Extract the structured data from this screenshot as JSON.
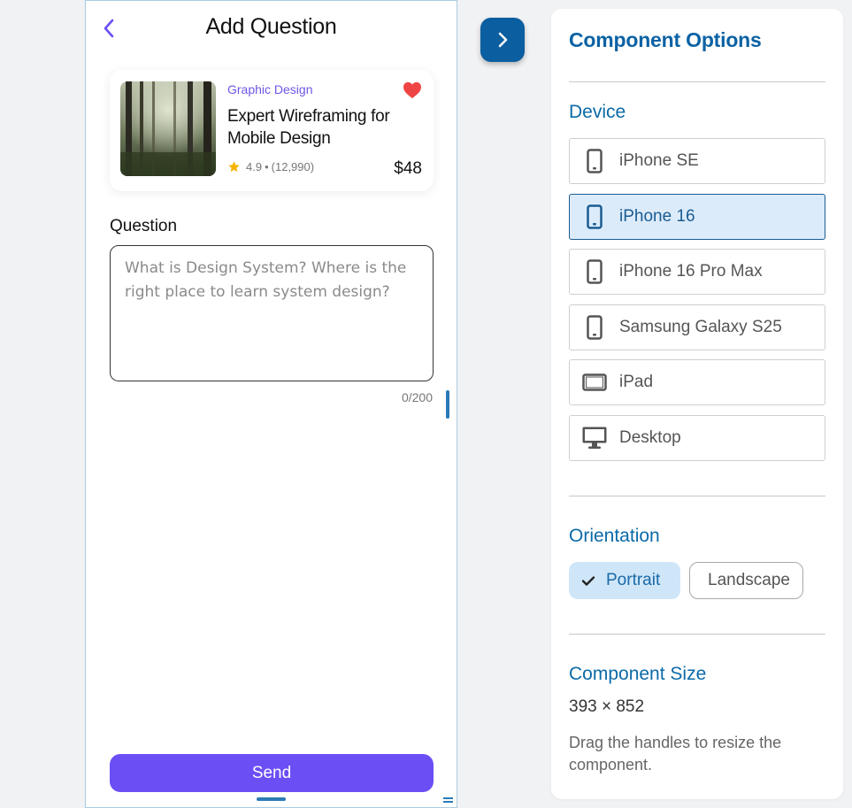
{
  "preview": {
    "title": "Add Question",
    "course": {
      "category": "Graphic Design",
      "title": "Expert Wireframing for Mobile Design",
      "rating": "4.9",
      "dot": "•",
      "reviews": "(12,990)",
      "price": "$48",
      "favorited": true
    },
    "question_label": "Question",
    "question_placeholder": "What is Design System? Where is the right place to learn system design?",
    "question_value": "",
    "char_count": "0/200",
    "send_label": "Send"
  },
  "panel": {
    "title": "Component Options",
    "device_section": "Device",
    "devices": [
      {
        "label": "iPhone SE",
        "icon": "phone-icon",
        "selected": false
      },
      {
        "label": "iPhone 16",
        "icon": "phone-icon",
        "selected": true
      },
      {
        "label": "iPhone 16 Pro Max",
        "icon": "phone-icon",
        "selected": false
      },
      {
        "label": "Samsung Galaxy S25",
        "icon": "phone-icon",
        "selected": false
      },
      {
        "label": "iPad",
        "icon": "tablet-icon",
        "selected": false
      },
      {
        "label": "Desktop",
        "icon": "monitor-icon",
        "selected": false
      }
    ],
    "orientation_section": "Orientation",
    "orientations": [
      {
        "label": "Portrait",
        "selected": true
      },
      {
        "label": "Landscape",
        "selected": false
      }
    ],
    "size_section": "Component Size",
    "size_value": "393 × 852",
    "size_help": "Drag the handles to resize the component."
  },
  "colors": {
    "accent_purple": "#6c4ef5",
    "accent_blue": "#0b62a4",
    "selected_bg": "#dcebfa",
    "heart": "#ef4444",
    "star": "#f5b400"
  }
}
